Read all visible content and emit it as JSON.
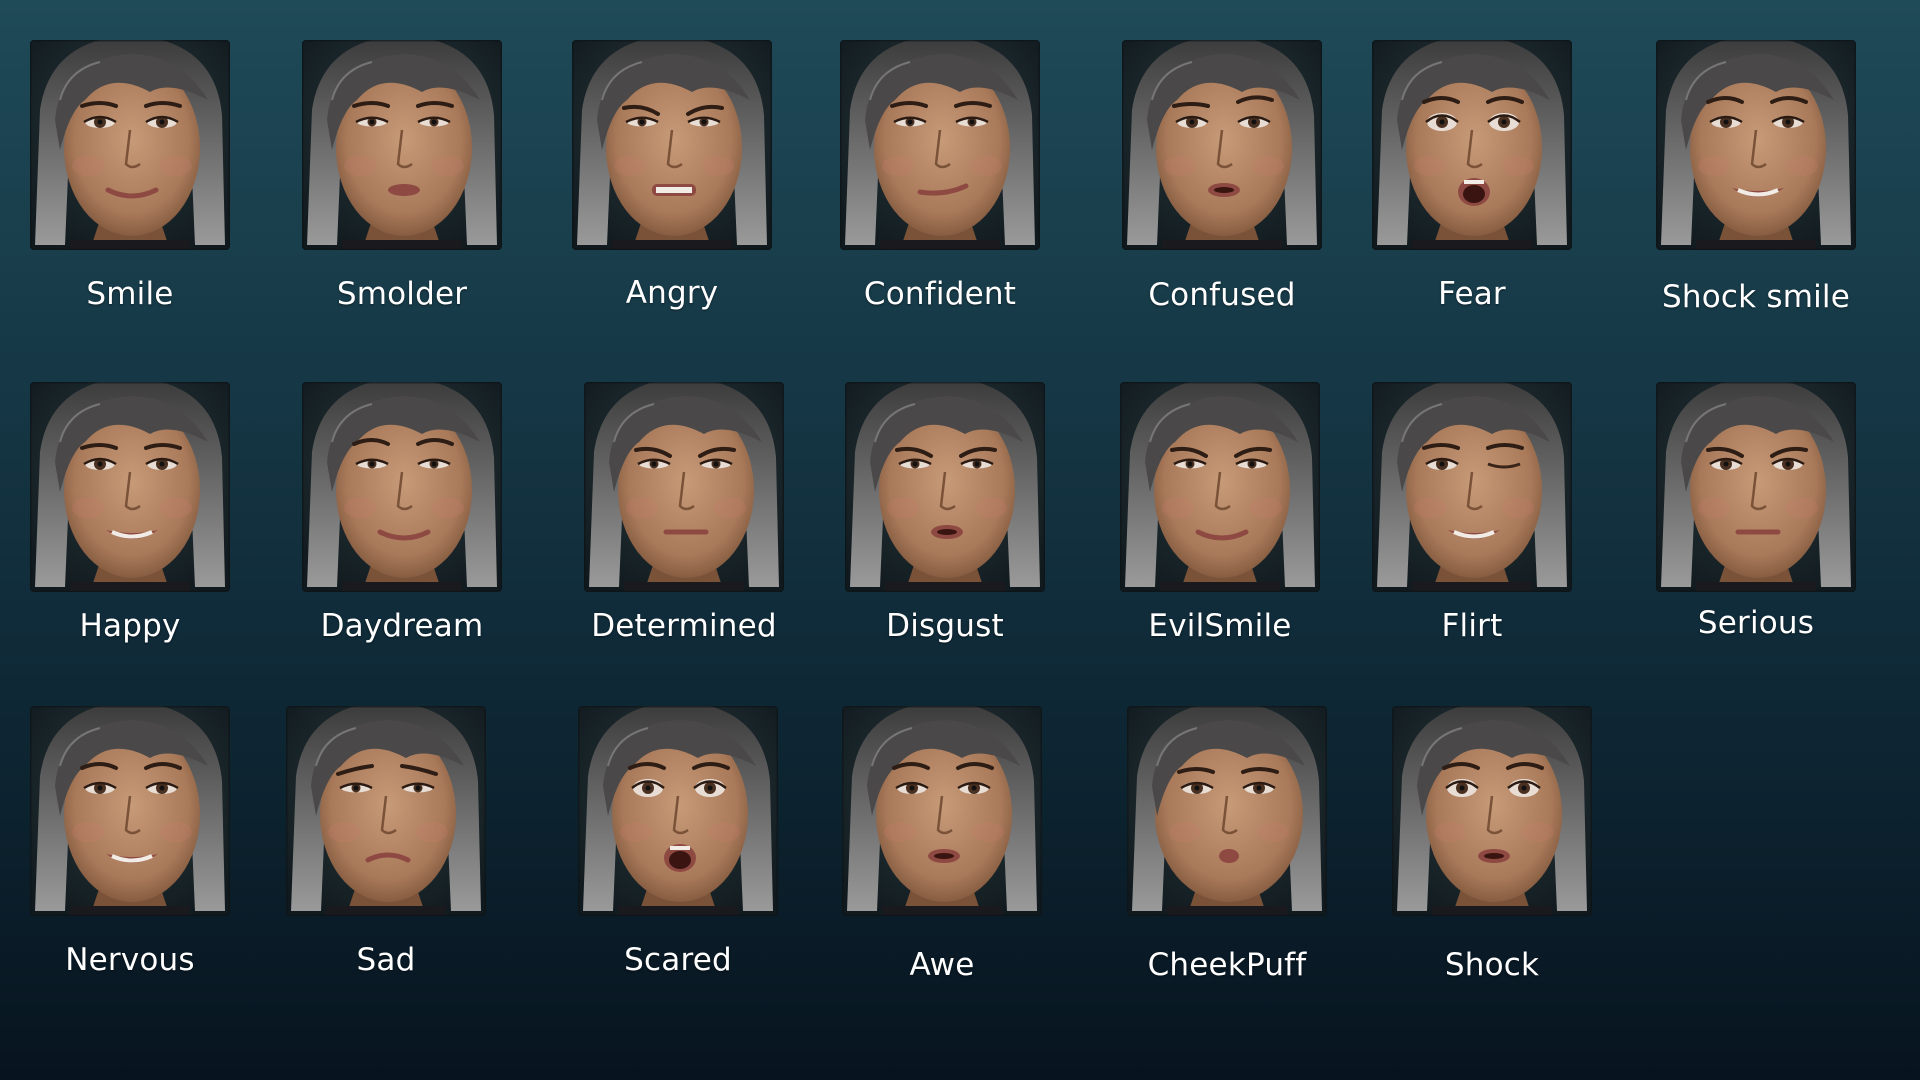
{
  "expressions": [
    {
      "label": "Smile"
    },
    {
      "label": "Smolder"
    },
    {
      "label": "Angry"
    },
    {
      "label": "Confident"
    },
    {
      "label": "Confused"
    },
    {
      "label": "Fear"
    },
    {
      "label": "Shock smile"
    },
    {
      "label": "Happy"
    },
    {
      "label": "Daydream"
    },
    {
      "label": "Determined"
    },
    {
      "label": "Disgust"
    },
    {
      "label": "EvilSmile"
    },
    {
      "label": "Flirt"
    },
    {
      "label": "Serious"
    },
    {
      "label": "Nervous"
    },
    {
      "label": "Sad"
    },
    {
      "label": "Scared"
    },
    {
      "label": "Awe"
    },
    {
      "label": "CheekPuff"
    },
    {
      "label": "Shock"
    }
  ]
}
